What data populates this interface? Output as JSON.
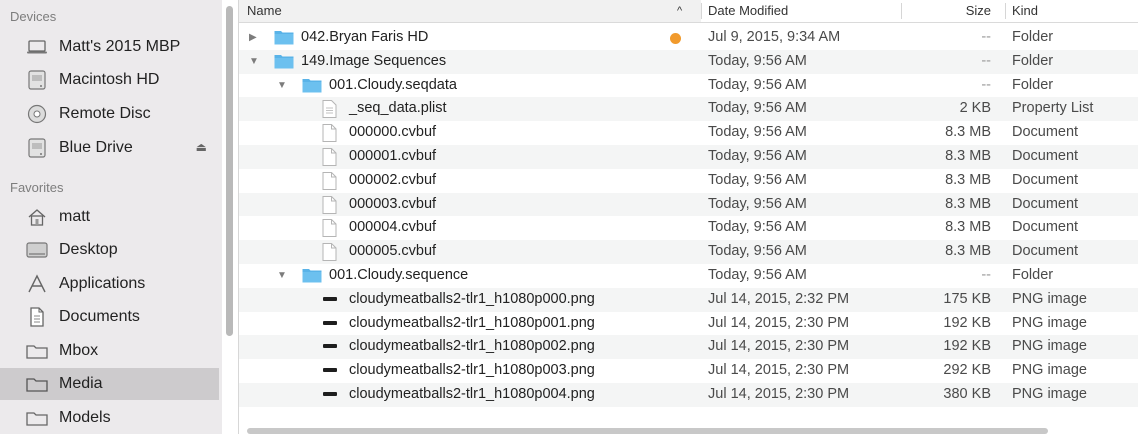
{
  "sidebar": {
    "devices_heading": "Devices",
    "favorites_heading": "Favorites",
    "devices": [
      {
        "label": "Matt's 2015 MBP",
        "icon": "laptop-icon"
      },
      {
        "label": "Macintosh HD",
        "icon": "hard-drive-icon"
      },
      {
        "label": "Remote Disc",
        "icon": "disc-icon"
      },
      {
        "label": "Blue Drive",
        "icon": "external-drive-icon",
        "eject": "⏏"
      }
    ],
    "favorites": [
      {
        "label": "matt",
        "icon": "home-icon"
      },
      {
        "label": "Desktop",
        "icon": "desktop-icon"
      },
      {
        "label": "Applications",
        "icon": "applications-icon"
      },
      {
        "label": "Documents",
        "icon": "documents-icon"
      },
      {
        "label": "Mbox",
        "icon": "folder-icon"
      },
      {
        "label": "Media",
        "icon": "folder-icon",
        "selected": true
      },
      {
        "label": "Models",
        "icon": "folder-icon"
      }
    ]
  },
  "columns": {
    "name": "Name",
    "date": "Date Modified",
    "size": "Size",
    "kind": "Kind",
    "sort_indicator": "^"
  },
  "rows": [
    {
      "name": "042.Bryan Faris HD",
      "date": "Jul 9, 2015, 9:34 AM",
      "size": "--",
      "kind": "Folder",
      "level": 0,
      "type": "folder",
      "disclosure": "▶",
      "tag": "orange"
    },
    {
      "name": "149.Image Sequences",
      "date": "Today, 9:56 AM",
      "size": "--",
      "kind": "Folder",
      "level": 0,
      "type": "folder",
      "disclosure": "▼"
    },
    {
      "name": "001.Cloudy.seqdata",
      "date": "Today, 9:56 AM",
      "size": "--",
      "kind": "Folder",
      "level": 1,
      "type": "folder",
      "disclosure": "▼"
    },
    {
      "name": "_seq_data.plist",
      "date": "Today, 9:56 AM",
      "size": "2 KB",
      "kind": "Property List",
      "level": 2,
      "type": "plist"
    },
    {
      "name": "000000.cvbuf",
      "date": "Today, 9:56 AM",
      "size": "8.3 MB",
      "kind": "Document",
      "level": 2,
      "type": "doc"
    },
    {
      "name": "000001.cvbuf",
      "date": "Today, 9:56 AM",
      "size": "8.3 MB",
      "kind": "Document",
      "level": 2,
      "type": "doc"
    },
    {
      "name": "000002.cvbuf",
      "date": "Today, 9:56 AM",
      "size": "8.3 MB",
      "kind": "Document",
      "level": 2,
      "type": "doc"
    },
    {
      "name": "000003.cvbuf",
      "date": "Today, 9:56 AM",
      "size": "8.3 MB",
      "kind": "Document",
      "level": 2,
      "type": "doc"
    },
    {
      "name": "000004.cvbuf",
      "date": "Today, 9:56 AM",
      "size": "8.3 MB",
      "kind": "Document",
      "level": 2,
      "type": "doc"
    },
    {
      "name": "000005.cvbuf",
      "date": "Today, 9:56 AM",
      "size": "8.3 MB",
      "kind": "Document",
      "level": 2,
      "type": "doc"
    },
    {
      "name": "001.Cloudy.sequence",
      "date": "Today, 9:56 AM",
      "size": "--",
      "kind": "Folder",
      "level": 1,
      "type": "folder",
      "disclosure": "▼"
    },
    {
      "name": "cloudymeatballs2-tlr1_h1080p000.png",
      "date": "Jul 14, 2015, 2:32 PM",
      "size": "175 KB",
      "kind": "PNG image",
      "level": 2,
      "type": "png"
    },
    {
      "name": "cloudymeatballs2-tlr1_h1080p001.png",
      "date": "Jul 14, 2015, 2:30 PM",
      "size": "192 KB",
      "kind": "PNG image",
      "level": 2,
      "type": "png"
    },
    {
      "name": "cloudymeatballs2-tlr1_h1080p002.png",
      "date": "Jul 14, 2015, 2:30 PM",
      "size": "192 KB",
      "kind": "PNG image",
      "level": 2,
      "type": "png"
    },
    {
      "name": "cloudymeatballs2-tlr1_h1080p003.png",
      "date": "Jul 14, 2015, 2:30 PM",
      "size": "292 KB",
      "kind": "PNG image",
      "level": 2,
      "type": "png"
    },
    {
      "name": "cloudymeatballs2-tlr1_h1080p004.png",
      "date": "Jul 14, 2015, 2:30 PM",
      "size": "380 KB",
      "kind": "PNG image",
      "level": 2,
      "type": "png"
    }
  ],
  "colors": {
    "folder": "#59b3e8",
    "tag_orange": "#f19a2c",
    "sidebar_bg": "#eceaec",
    "selected_bg": "#cdcbcd"
  }
}
